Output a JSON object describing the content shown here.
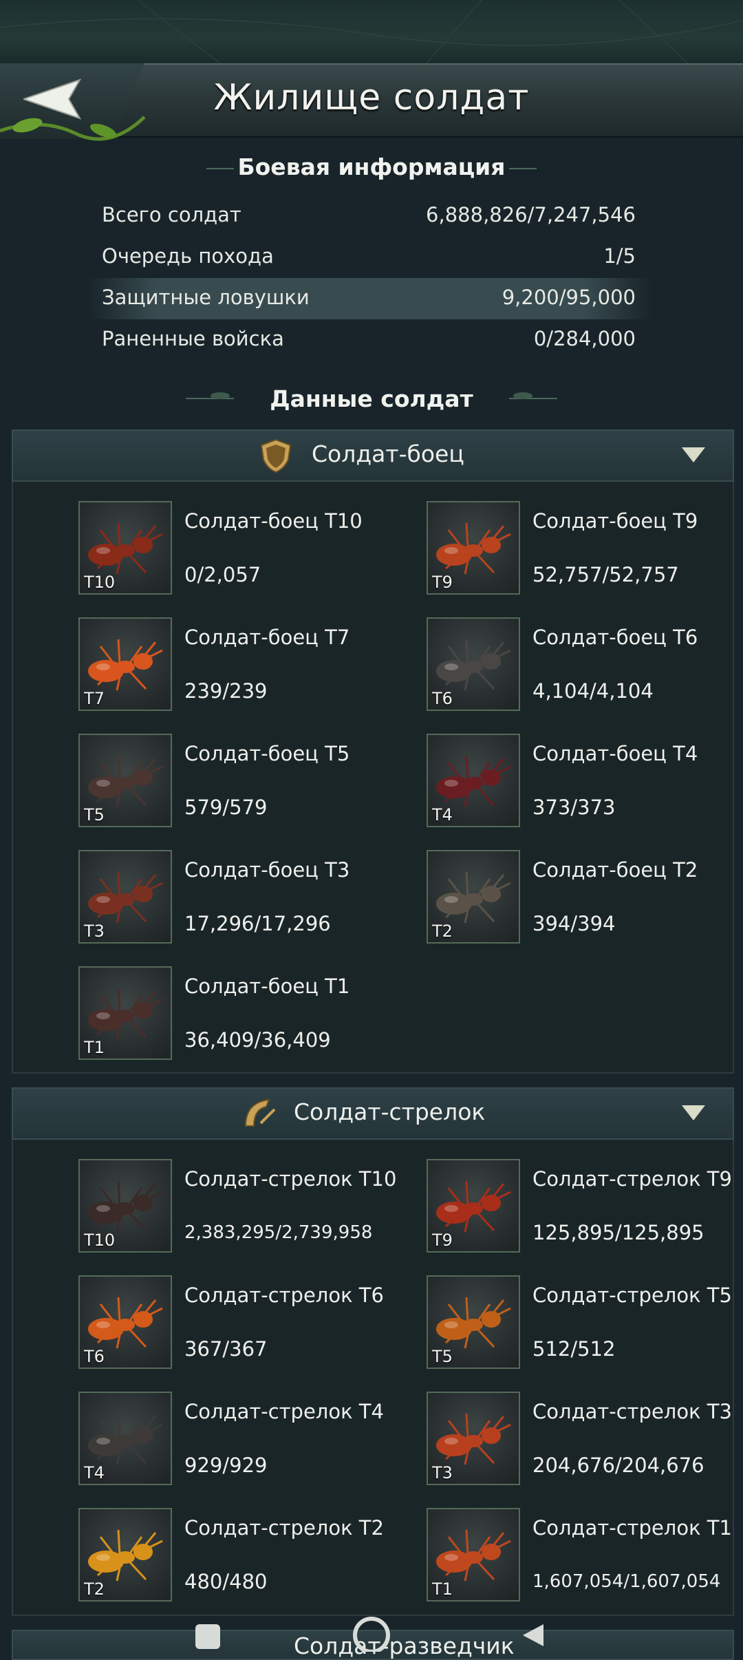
{
  "header": {
    "title": "Жилище солдат",
    "back_label": "Назад"
  },
  "battle_info": {
    "title": "Боевая информация",
    "rows": [
      {
        "label": "Всего солдат",
        "value": "6,888,826/7,247,546"
      },
      {
        "label": "Очередь похода",
        "value": "1/5"
      },
      {
        "label": "Защитные ловушки",
        "value": "9,200/95,000"
      },
      {
        "label": "Раненные войска",
        "value": "0/284,000"
      }
    ]
  },
  "soldier_data": {
    "title": "Данные солдат"
  },
  "fighter": {
    "title": "Солдат-боец",
    "units": [
      {
        "name": "Солдат-боец Т10",
        "tier": "T10",
        "count": "0/2,057",
        "color": "#8a2a18"
      },
      {
        "name": "Солдат-боец Т9",
        "tier": "T9",
        "count": "52,757/52,757",
        "color": "#b8431e"
      },
      {
        "name": "Солдат-боец Т7",
        "tier": "T7",
        "count": "239/239",
        "color": "#d8561e"
      },
      {
        "name": "Солдат-боец Т6",
        "tier": "T6",
        "count": "4,104/4,104",
        "color": "#4a4646"
      },
      {
        "name": "Солдат-боец Т5",
        "tier": "T5",
        "count": "579/579",
        "color": "#4a3530"
      },
      {
        "name": "Солдат-боец Т4",
        "tier": "T4",
        "count": "373/373",
        "color": "#6a1e22"
      },
      {
        "name": "Солдат-боец Т3",
        "tier": "T3",
        "count": "17,296/17,296",
        "color": "#7a3020"
      },
      {
        "name": "Солдат-боец Т2",
        "tier": "T2",
        "count": "394/394",
        "color": "#5a5248"
      },
      {
        "name": "Солдат-боец Т1",
        "tier": "T1",
        "count": "36,409/36,409",
        "color": "#4a2e2a"
      }
    ]
  },
  "shooter": {
    "title": "Солдат-стрелок",
    "units": [
      {
        "name": "Солдат-стрелок Т10",
        "tier": "T10",
        "count": "2,383,295/2,739,958",
        "color": "#3a2a28"
      },
      {
        "name": "Солдат-стрелок Т9",
        "tier": "T9",
        "count": "125,895/125,895",
        "color": "#a82e1a"
      },
      {
        "name": "Солдат-стрелок Т6",
        "tier": "T6",
        "count": "367/367",
        "color": "#d45a1a"
      },
      {
        "name": "Солдат-стрелок Т5",
        "tier": "T5",
        "count": "512/512",
        "color": "#c06018"
      },
      {
        "name": "Солдат-стрелок Т4",
        "tier": "T4",
        "count": "929/929",
        "color": "#3e3a38"
      },
      {
        "name": "Солдат-стрелок Т3",
        "tier": "T3",
        "count": "204,676/204,676",
        "color": "#b8401e"
      },
      {
        "name": "Солдат-стрелок Т2",
        "tier": "T2",
        "count": "480/480",
        "color": "#d8921a"
      },
      {
        "name": "Солдат-стрелок Т1",
        "tier": "T1",
        "count": "1,607,054/1,607,054",
        "color": "#c0481e"
      }
    ]
  },
  "next_section": {
    "title": "Солдат-разведчик"
  }
}
